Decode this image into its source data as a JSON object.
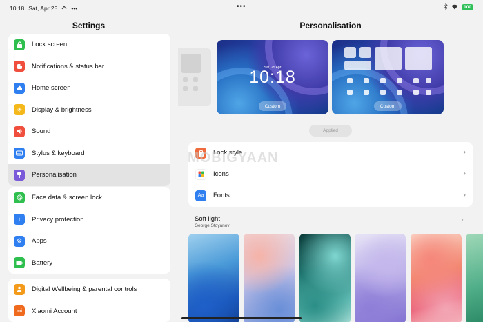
{
  "status_bar": {
    "time": "10:18",
    "date": "Sat, Apr 25",
    "center_dots": "•••",
    "battery": "100"
  },
  "sidebar": {
    "title": "Settings",
    "groups": [
      {
        "items": [
          {
            "label": "Lock screen",
            "icon": "lock-icon",
            "color": "#2fbf4f"
          },
          {
            "label": "Notifications & status bar",
            "icon": "notification-icon",
            "color": "#ef4f3c"
          },
          {
            "label": "Home screen",
            "icon": "home-icon",
            "color": "#2f7ff0"
          },
          {
            "label": "Display & brightness",
            "icon": "sun-icon",
            "color": "#f4b81b"
          },
          {
            "label": "Sound",
            "icon": "speaker-icon",
            "color": "#ef4f3c"
          },
          {
            "label": "Stylus & keyboard",
            "icon": "keyboard-icon",
            "color": "#2f7ff0"
          },
          {
            "label": "Personalisation",
            "icon": "brush-icon",
            "color": "#7a5ad8"
          }
        ]
      },
      {
        "items": [
          {
            "label": "Face data & screen lock",
            "icon": "face-icon",
            "color": "#2fbf4f"
          },
          {
            "label": "Privacy protection",
            "icon": "info-icon",
            "color": "#2f7ff0"
          },
          {
            "label": "Apps",
            "icon": "gear-icon",
            "color": "#2f7ff0"
          },
          {
            "label": "Battery",
            "icon": "battery-icon",
            "color": "#2fbf4f"
          }
        ]
      },
      {
        "items": [
          {
            "label": "Digital Wellbeing & parental controls",
            "icon": "person-icon",
            "color": "#f39a1b"
          },
          {
            "label": "Xiaomi Account",
            "icon": "mi-icon",
            "color": "#f06a1e"
          }
        ]
      }
    ]
  },
  "main": {
    "title": "Personalisation",
    "lock_preview": {
      "date": "Sat, 25 Apr",
      "time": "10:18",
      "button": "Custom"
    },
    "home_preview": {
      "button": "Custom"
    },
    "applied_button": "Applied",
    "options": [
      {
        "label": "Lock style",
        "icon": "lock-icon",
        "color": "#ef6a3c"
      },
      {
        "label": "Icons",
        "icon": "grid-icon",
        "color": "#ffffff"
      },
      {
        "label": "Fonts",
        "icon": "font-icon",
        "color": "#2f7ff0",
        "icon_text": "Aa"
      }
    ],
    "watermark": "MOBIGYAAN",
    "wallpaper_section": {
      "title": "Soft light",
      "author": "George Stoyanov",
      "count": "7"
    }
  }
}
